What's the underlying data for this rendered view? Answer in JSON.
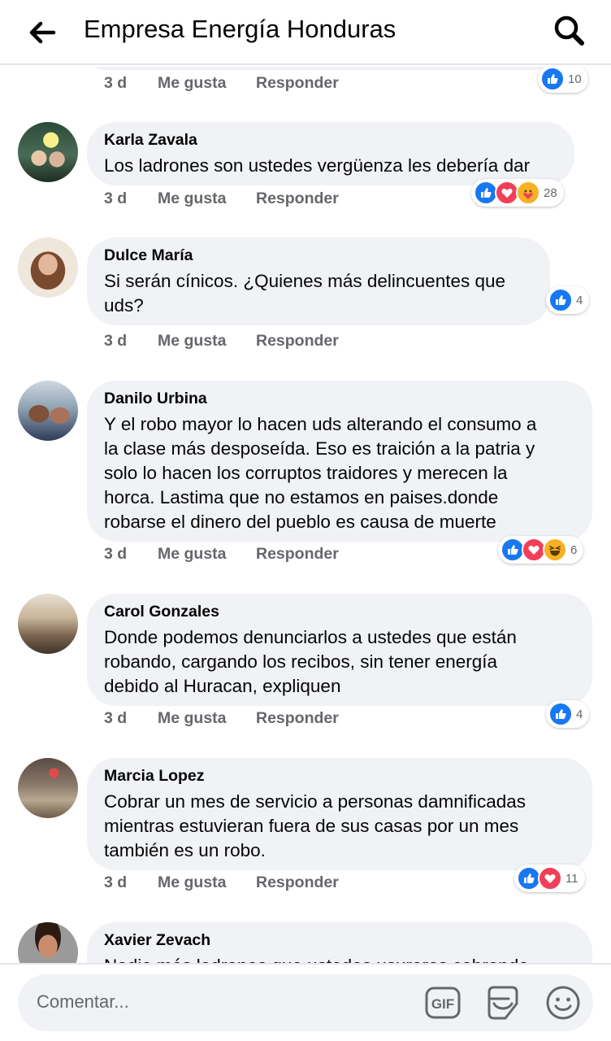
{
  "header": {
    "title": "Empresa Energía Honduras"
  },
  "top_partial": {
    "age": "3 d",
    "like_label": "Me gusta",
    "reply_label": "Responder",
    "reactions": [
      "like"
    ],
    "count": "10"
  },
  "comments": [
    {
      "author": "Karla Zavala",
      "lines": [
        "Los ladrones son ustedes vergüenza les debería dar"
      ],
      "age": "3 d",
      "like_label": "Me gusta",
      "reply_label": "Responder",
      "reactions": [
        "like",
        "love",
        "care"
      ],
      "count": "28"
    },
    {
      "author": "Dulce María",
      "lines": [
        "Si serán cínicos. ¿Quienes más delincuentes que",
        "uds?"
      ],
      "age": "3 d",
      "like_label": "Me gusta",
      "reply_label": "Responder",
      "reactions": [
        "like"
      ],
      "count": "4"
    },
    {
      "author": "Danilo Urbina",
      "lines": [
        "Y el robo mayor  lo hacen uds alterando el consumo a",
        "la clase más desposeída. Eso es traición a la patria y",
        "solo lo hacen los corruptos traidores y merecen la",
        "horca. Lastima que no estamos en paises.donde",
        "robarse el dinero del pueblo es causa de muerte"
      ],
      "age": "3 d",
      "like_label": "Me gusta",
      "reply_label": "Responder",
      "reactions": [
        "like",
        "love",
        "haha"
      ],
      "count": "6"
    },
    {
      "author": "Carol Gonzales",
      "lines": [
        "Donde podemos denunciarlos a ustedes que están",
        "robando, cargando los recibos, sin tener energía",
        "debido al Huracan, expliquen"
      ],
      "age": "3 d",
      "like_label": "Me gusta",
      "reply_label": "Responder",
      "reactions": [
        "like"
      ],
      "count": "4"
    },
    {
      "author": "Marcia Lopez",
      "lines": [
        "Cobrar un mes de servicio a personas damnificadas",
        "mientras estuvieran fuera de sus casas por un mes",
        "también es un robo."
      ],
      "age": "3 d",
      "like_label": "Me gusta",
      "reply_label": "Responder",
      "reactions": [
        "like",
        "love"
      ],
      "count": "11"
    },
    {
      "author": "Xavier Zevach",
      "lines": [
        "Nadie más ladrones que ustedes usureros cobrando"
      ]
    }
  ],
  "composer": {
    "placeholder": "Comentar..."
  },
  "icons": {
    "back": "back-arrow-icon",
    "search": "search-icon",
    "gif": "gif-icon",
    "sticker": "sticker-icon",
    "emoji": "emoji-icon"
  },
  "colors": {
    "like": "#1877f2",
    "love": "#f33e58",
    "care": "#f7b125",
    "haha": "#f7b125",
    "meta_text": "#65676b",
    "bubble": "#f0f2f5"
  }
}
